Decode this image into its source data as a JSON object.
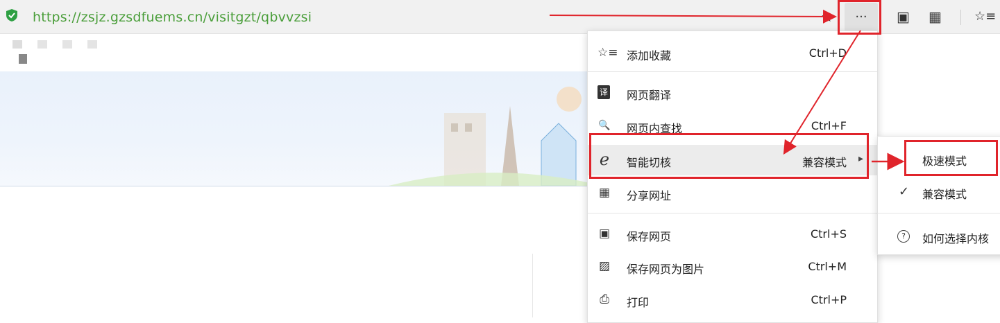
{
  "addressbar": {
    "url": "https://zsjz.gzsdfuems.cn/visitgzt/qbvvzsi",
    "star_icon": "★",
    "more_label": "···",
    "reader_icon": "▣",
    "apps_icon": "▦",
    "favorites_icon": "☆≡"
  },
  "menu": {
    "items": [
      {
        "icon": "☆≡",
        "label": "添加收藏",
        "shortcut": "Ctrl+D"
      },
      {
        "icon": "译",
        "label": "网页翻译",
        "shortcut": ""
      },
      {
        "icon": "🔍",
        "label": "网页内查找",
        "shortcut": "Ctrl+F"
      },
      {
        "icon": "ℯ",
        "label": "智能切核",
        "shortcut": "兼容模式",
        "arrow": "▸"
      },
      {
        "icon": "▦",
        "label": "分享网址",
        "shortcut": ""
      },
      {
        "icon": "▣",
        "label": "保存网页",
        "shortcut": "Ctrl+S"
      },
      {
        "icon": "▨",
        "label": "保存网页为图片",
        "shortcut": "Ctrl+M"
      },
      {
        "icon": "⎙",
        "label": "打印",
        "shortcut": "Ctrl+P"
      }
    ]
  },
  "submenu": {
    "items": [
      {
        "icon": "",
        "label": "极速模式"
      },
      {
        "icon": "✓",
        "label": "兼容模式"
      },
      {
        "icon": "?",
        "label": "如何选择内核"
      }
    ]
  },
  "colors": {
    "annotation_red": "#e0242b",
    "url_green": "#4a9e3a"
  }
}
